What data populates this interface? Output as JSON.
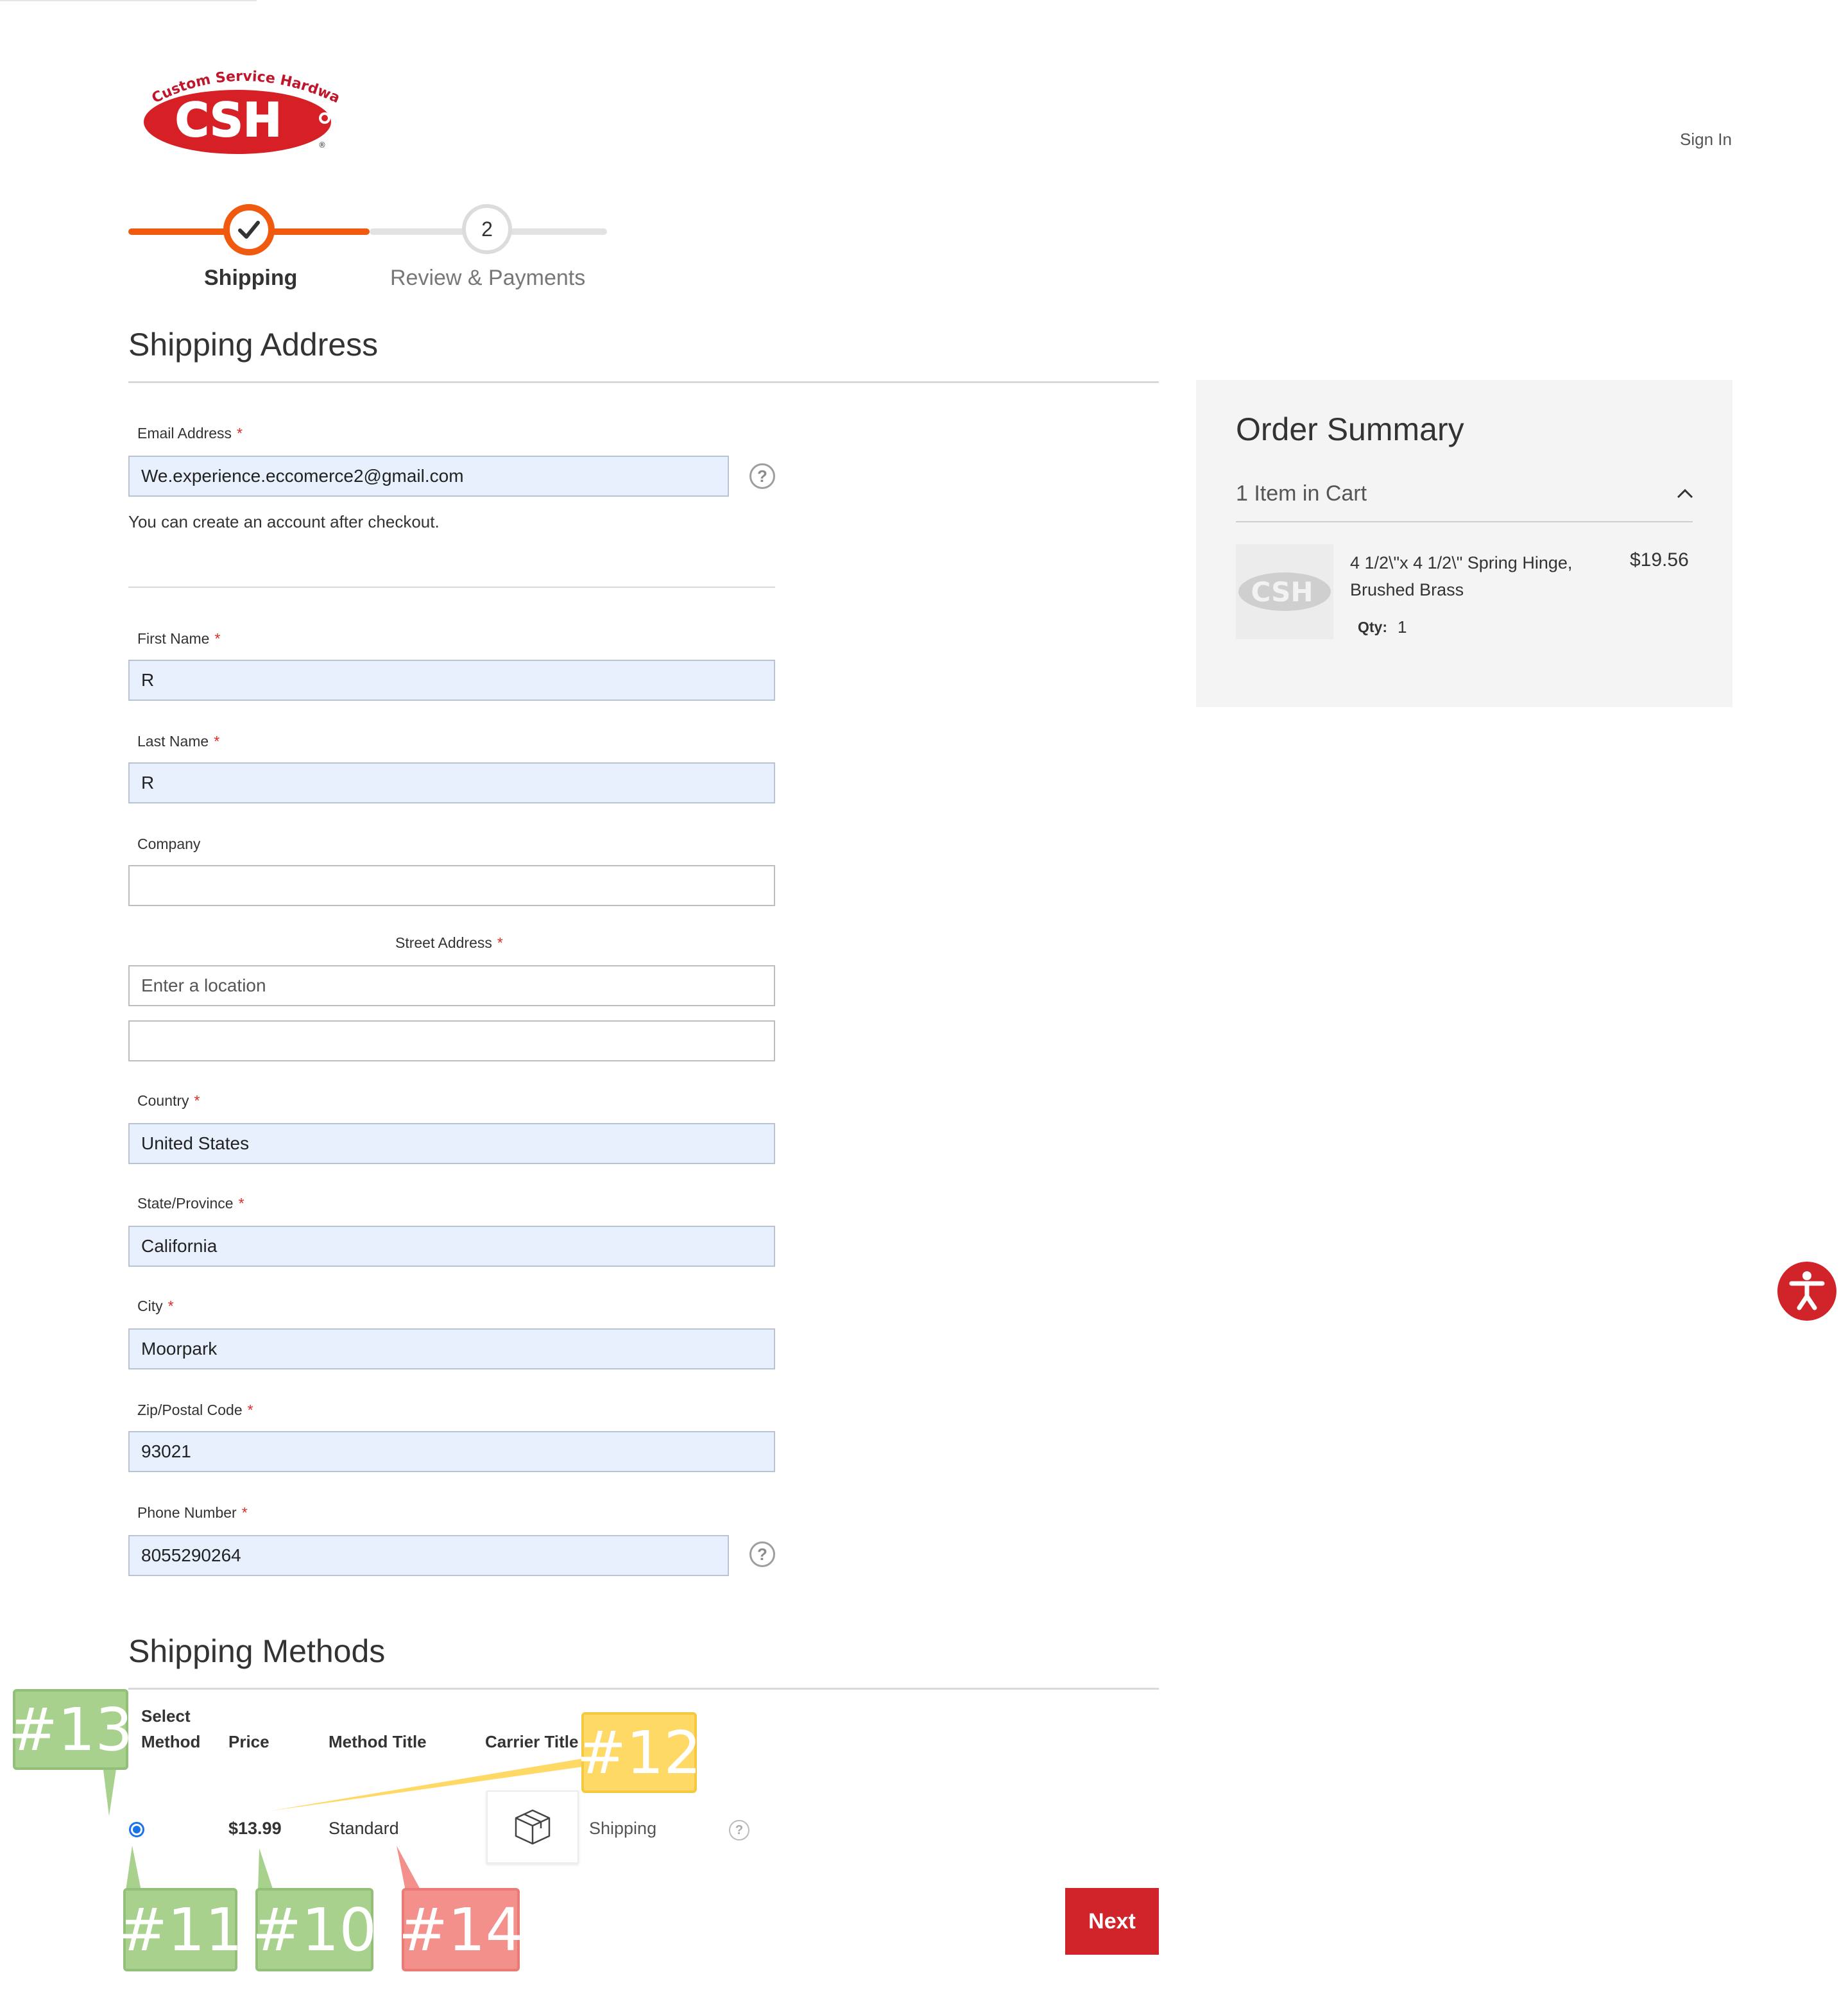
{
  "header": {
    "logo_top": "Custom Service Hardware",
    "logo_main": "CSH",
    "sign_in": "Sign In"
  },
  "progress": {
    "step1_label": "Shipping",
    "step2_number": "2",
    "step2_label": "Review & Payments"
  },
  "shipping_address": {
    "title": "Shipping Address",
    "email_label": "Email Address",
    "email_value": "We.experience.eccomerce2@gmail.com",
    "email_note": "You can create an account after checkout.",
    "first_name_label": "First Name",
    "first_name_value": "R",
    "last_name_label": "Last Name",
    "last_name_value": "R",
    "company_label": "Company",
    "company_value": "",
    "street_label": "Street Address",
    "street_placeholder": "Enter a location",
    "street_line2": "",
    "country_label": "Country",
    "country_value": "United States",
    "state_label": "State/Province",
    "state_value": "California",
    "city_label": "City",
    "city_value": "Moorpark",
    "zip_label": "Zip/Postal Code",
    "zip_value": "93021",
    "phone_label": "Phone Number",
    "phone_value": "8055290264",
    "required_mark": "*",
    "help_glyph": "?"
  },
  "order_summary": {
    "title": "Order Summary",
    "items_in_cart": "1 Item in Cart",
    "item_name_line1": "4 1/2\\\"x 4 1/2\\\" Spring Hinge,",
    "item_name_line2": "Brushed Brass",
    "item_price": "$19.56",
    "qty_label": "Qty:",
    "qty_value": "1",
    "thumb_text": "CSH"
  },
  "shipping_methods": {
    "title": "Shipping Methods",
    "headers": {
      "select_line1": "Select",
      "select_line2": "Method",
      "price": "Price",
      "method_title": "Method Title",
      "carrier_title": "Carrier Title"
    },
    "row": {
      "price": "$13.99",
      "method": "Standard",
      "carrier": "Shipping",
      "selected": true
    },
    "next_button": "Next"
  },
  "annotations": {
    "tag13": "#13",
    "tag12": "#12",
    "tag11": "#11",
    "tag10": "#10",
    "tag14": "#14"
  },
  "colors": {
    "accent": "#f05a0e",
    "brand_red": "#d0232a",
    "autofill_bg": "#e8f0fe",
    "summary_bg": "#f4f4f4"
  }
}
